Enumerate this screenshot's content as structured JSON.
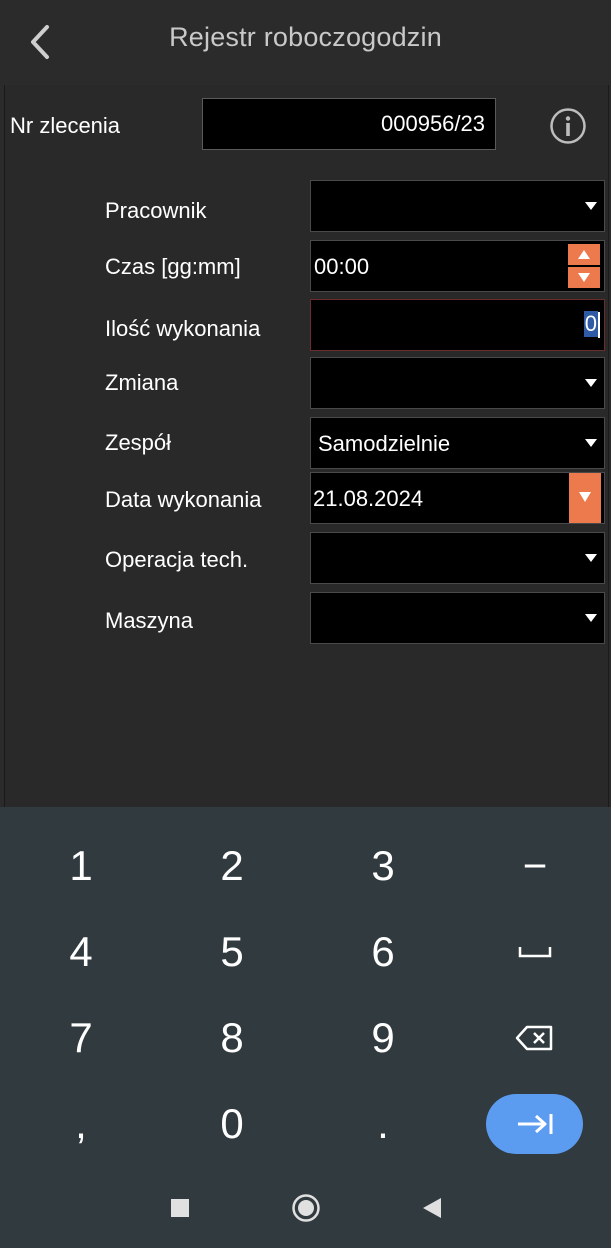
{
  "header": {
    "title": "Rejestr roboczogodzin",
    "back_icon": "chevron-left-icon"
  },
  "order": {
    "label": "Nr zlecenia",
    "value": "000956/23",
    "info_icon": "info-icon"
  },
  "fields": {
    "pracownik": {
      "label": "Pracownik",
      "value": ""
    },
    "czas": {
      "label": "Czas [gg:mm]",
      "value": "00:00"
    },
    "ilosc": {
      "label": "Ilość wykonania",
      "value": "0"
    },
    "zmiana": {
      "label": "Zmiana",
      "value": ""
    },
    "zespol": {
      "label": "Zespół",
      "value": "Samodzielnie"
    },
    "data": {
      "label": "Data wykonania",
      "value": "21.08.2024"
    },
    "operacja": {
      "label": "Operacja tech.",
      "value": ""
    },
    "maszyna": {
      "label": "Maszyna",
      "value": ""
    }
  },
  "keyboard": {
    "keys": [
      "1",
      "2",
      "3",
      "−",
      "4",
      "5",
      "6",
      "␣",
      "7",
      "8",
      "9",
      "⌫",
      ",",
      "0",
      ".",
      "⇥"
    ],
    "special_icons": {
      "space": "space-icon",
      "backspace": "backspace-icon",
      "enter": "tab-next-icon"
    }
  },
  "navbar": {
    "icons": [
      "recents-square-icon",
      "home-circle-icon",
      "back-triangle-icon"
    ]
  },
  "colors": {
    "accent": "#ec7a4c",
    "enter_key": "#5b9bf0",
    "keyboard_bg": "#313a3e",
    "selection": "#2f5aa6"
  }
}
